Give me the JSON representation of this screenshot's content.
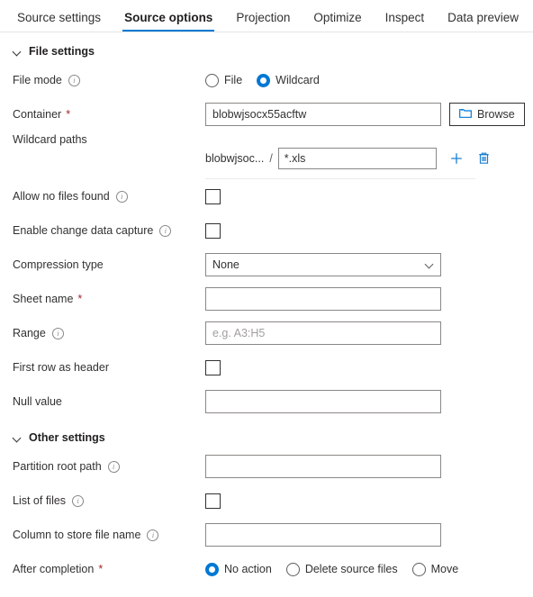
{
  "tabs": [
    {
      "label": "Source settings",
      "active": false
    },
    {
      "label": "Source options",
      "active": true
    },
    {
      "label": "Projection",
      "active": false
    },
    {
      "label": "Optimize",
      "active": false
    },
    {
      "label": "Inspect",
      "active": false
    },
    {
      "label": "Data preview",
      "active": false
    }
  ],
  "colors": {
    "accent": "#0078d4",
    "required": "#a4262c",
    "text": "#323130",
    "border": "#8a8886"
  },
  "file_settings": {
    "section_label": "File settings",
    "file_mode": {
      "label": "File mode",
      "options": [
        "File",
        "Wildcard"
      ],
      "selected": "Wildcard"
    },
    "container": {
      "label": "Container",
      "required": "*",
      "value": "blobwjsocx55acftw",
      "browse_label": "Browse"
    },
    "wildcard_paths": {
      "label": "Wildcard paths",
      "prefix": "blobwjsoc...",
      "separator": "/",
      "value": "*.xls",
      "add_label": "+",
      "delete_label": "Delete"
    },
    "allow_no_files_found": {
      "label": "Allow no files found",
      "checked": false
    },
    "enable_change_data_capture": {
      "label": "Enable change data capture",
      "checked": false
    },
    "compression_type": {
      "label": "Compression type",
      "value": "None"
    },
    "sheet_name": {
      "label": "Sheet name",
      "required": "*",
      "value": "",
      "placeholder": ""
    },
    "range": {
      "label": "Range",
      "value": "",
      "placeholder": "e.g. A3:H5"
    },
    "first_row_as_header": {
      "label": "First row as header",
      "checked": false
    },
    "null_value": {
      "label": "Null value",
      "value": "",
      "placeholder": ""
    }
  },
  "other_settings": {
    "section_label": "Other settings",
    "partition_root_path": {
      "label": "Partition root path",
      "value": "",
      "placeholder": ""
    },
    "list_of_files": {
      "label": "List of files",
      "checked": false
    },
    "column_to_store_file_name": {
      "label": "Column to store file name",
      "value": "",
      "placeholder": ""
    },
    "after_completion": {
      "label": "After completion",
      "required": "*",
      "options": [
        "No action",
        "Delete source files",
        "Move"
      ],
      "selected": "No action"
    }
  }
}
